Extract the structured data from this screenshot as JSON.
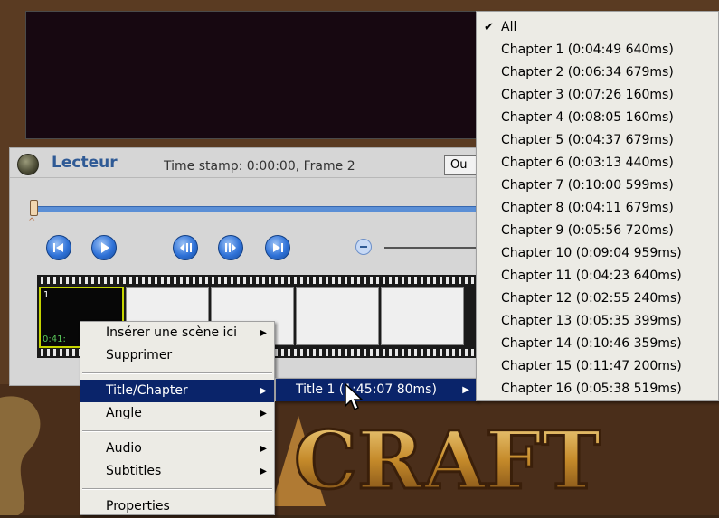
{
  "player": {
    "title": "Lecteur",
    "time_stamp": "Time stamp: 0:00:00, Frame 2",
    "out_button_label": "Ou",
    "thumbnail": {
      "number": "1",
      "time": "0:41:"
    }
  },
  "context_menu": {
    "items": [
      {
        "label": "Insérer une scène ici",
        "has_submenu": true
      },
      {
        "label": "Supprimer",
        "has_submenu": false
      },
      {
        "label": "Title/Chapter",
        "has_submenu": true,
        "selected": true
      },
      {
        "label": "Angle",
        "has_submenu": true
      },
      {
        "label": "Audio",
        "has_submenu": true
      },
      {
        "label": "Subtitles",
        "has_submenu": true
      },
      {
        "label": "Properties",
        "has_submenu": false
      }
    ]
  },
  "title_submenu": {
    "items": [
      {
        "label": "Title 1 (1:45:07 80ms)",
        "has_submenu": true,
        "selected": true
      }
    ]
  },
  "chapter_submenu": {
    "items": [
      {
        "label": "All",
        "checked": true
      },
      {
        "label": "Chapter 1 (0:04:49 640ms)"
      },
      {
        "label": "Chapter 2 (0:06:34 679ms)"
      },
      {
        "label": "Chapter 3 (0:07:26 160ms)"
      },
      {
        "label": "Chapter 4 (0:08:05 160ms)"
      },
      {
        "label": "Chapter 5 (0:04:37 679ms)"
      },
      {
        "label": "Chapter 6 (0:03:13 440ms)"
      },
      {
        "label": "Chapter 7 (0:10:00 599ms)"
      },
      {
        "label": "Chapter 8 (0:04:11 679ms)"
      },
      {
        "label": "Chapter 9 (0:05:56 720ms)"
      },
      {
        "label": "Chapter 10 (0:09:04 959ms)"
      },
      {
        "label": "Chapter 11 (0:04:23 640ms)"
      },
      {
        "label": "Chapter 12 (0:02:55 240ms)"
      },
      {
        "label": "Chapter 13 (0:05:35 399ms)"
      },
      {
        "label": "Chapter 14 (0:10:46 359ms)"
      },
      {
        "label": "Chapter 15 (0:11:47 200ms)"
      },
      {
        "label": "Chapter 16 (0:05:38 519ms)"
      }
    ]
  },
  "background": {
    "text": "CRAFT"
  },
  "colors": {
    "menu_highlight": "#0a246a",
    "menu_bg": "#ecebe5",
    "player_title": "#2f5a95",
    "thumb_border": "#c5d400"
  }
}
